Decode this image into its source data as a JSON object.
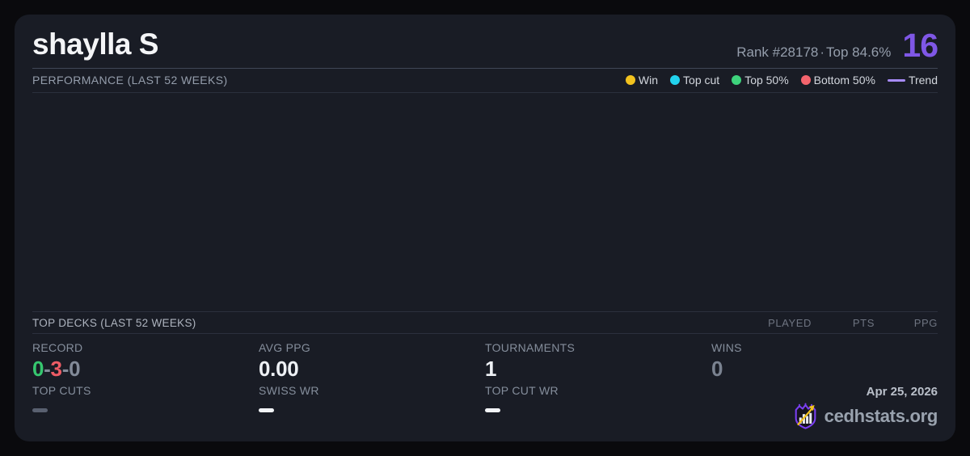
{
  "player": {
    "name": "shaylla S",
    "rank_label": "Rank #28178",
    "separator": "·",
    "top_percent_label": "Top 84.6%",
    "score": "16",
    "score_color": "#7f57e6"
  },
  "performance": {
    "title": "PERFORMANCE (LAST 52 WEEKS)",
    "legend": [
      {
        "label": "Win",
        "color": "#f2c21e",
        "marker": "dot"
      },
      {
        "label": "Top cut",
        "color": "#22d3ee",
        "marker": "dot"
      },
      {
        "label": "Top 50%",
        "color": "#3ed37c",
        "marker": "dot"
      },
      {
        "label": "Bottom 50%",
        "color": "#f4646d",
        "marker": "dot"
      },
      {
        "label": "Trend",
        "color": "#a78bfa",
        "marker": "line"
      }
    ],
    "chart_points": []
  },
  "top_decks": {
    "title": "TOP DECKS (LAST 52 WEEKS)",
    "columns": [
      "PLAYED",
      "PTS",
      "PPG"
    ],
    "rows": []
  },
  "stats": {
    "record": {
      "label": "RECORD",
      "wins": "0",
      "losses": "3",
      "draws": "0",
      "separator": "-",
      "wins_color": "#36c76f",
      "losses_color": "#ee5c65",
      "draws_color": "#828a98"
    },
    "avg_ppg": {
      "label": "AVG PPG",
      "value": "0.00"
    },
    "tournaments": {
      "label": "TOURNAMENTS",
      "value": "1"
    },
    "wins": {
      "label": "WINS",
      "value": "0"
    },
    "top_cuts": {
      "label": "TOP CUTS",
      "value": "—"
    },
    "swiss_wr": {
      "label": "SWISS WR",
      "value": "—"
    },
    "top_cut_wr": {
      "label": "TOP CUT WR",
      "value": "—"
    }
  },
  "footer": {
    "date": "Apr 25, 2026",
    "brand": "cedhstats.org"
  },
  "theme": {
    "page_bg": "#0a0a0d",
    "card_bg": "#191c25",
    "divider": "#2b303d",
    "accent_purple": "#7f57e6"
  }
}
